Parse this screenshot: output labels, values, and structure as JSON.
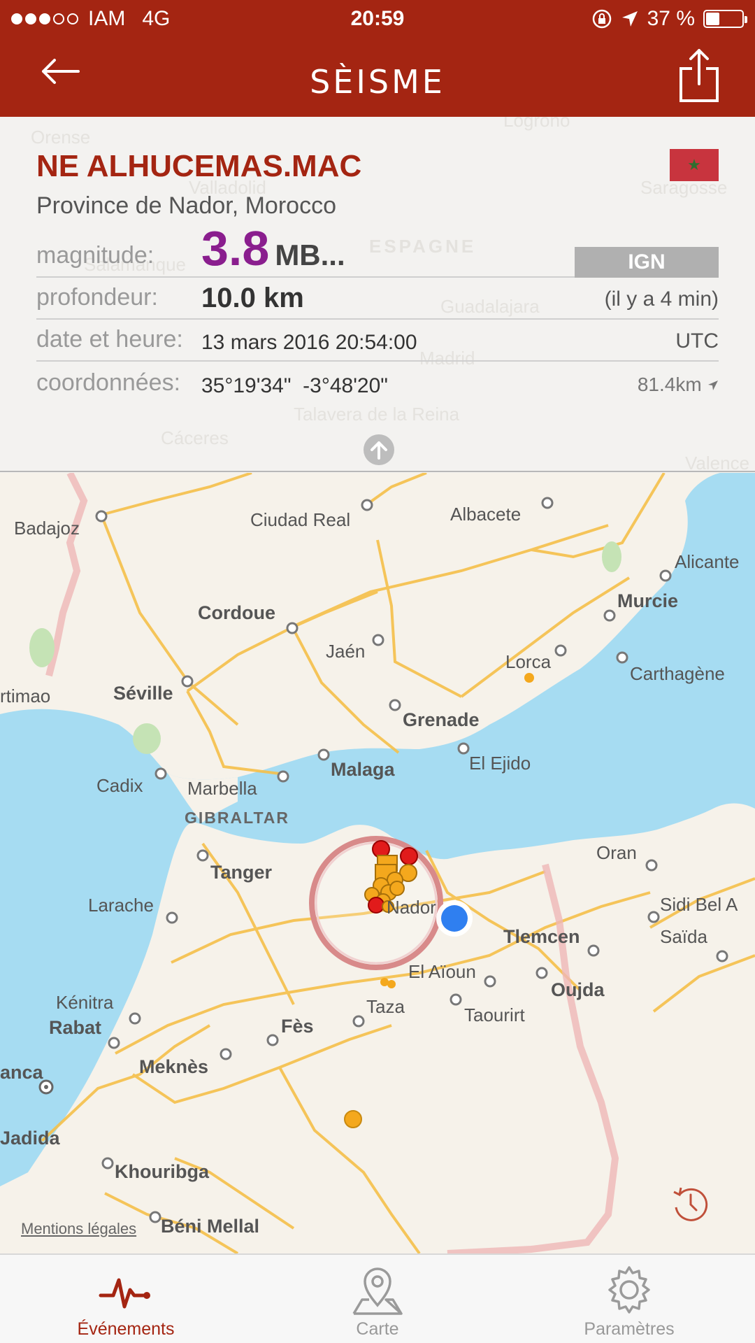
{
  "status": {
    "carrier": "IAM",
    "network": "4G",
    "time": "20:59",
    "battery": "37 %",
    "battery_level": 0.37,
    "signal_bars": 3
  },
  "header": {
    "title": "SÈISME",
    "back_icon": "arrow-left-icon",
    "share_icon": "share-icon"
  },
  "event": {
    "place": "NE ALHUCEMAS.MAC",
    "region": "Province de Nador, Morocco",
    "flag": "morocco-flag",
    "magnitude_label": "magnitude:",
    "magnitude": "3.8",
    "magnitude_unit": "MB...",
    "source_button": "IGN",
    "depth_label": "profondeur:",
    "depth": "10.0 km",
    "ago": "(il y a 4 min)",
    "datetime_label": "date et heure:",
    "datetime": "13 mars 2016 20:54:00",
    "timezone": "UTC",
    "coords_label": "coordonnées:",
    "coords": "35°19'34\"  -3°48'20\"",
    "distance": "81.4km"
  },
  "info_background": [
    "Orense",
    "Logroño",
    "Valladolid",
    "Saragosse",
    "ESPAGNE",
    "Guadalajara",
    "Madrid",
    "Talavera de la Reina",
    "Cáceres",
    "Valence",
    "Salamanque"
  ],
  "map": {
    "cities": {
      "badajoz": "Badajoz",
      "ciudad_real": "Ciudad Real",
      "albacete": "Albacete",
      "alicante": "Alicante",
      "cordoue": "Cordoue",
      "murcie": "Murcie",
      "jaen": "Jaén",
      "lorca": "Lorca",
      "carthagene": "Carthagène",
      "portimao": "rtimao",
      "seville": "Séville",
      "grenade": "Grenade",
      "malaga": "Malaga",
      "el_ejido": "El Ejido",
      "cadix": "Cadix",
      "marbella": "Marbella",
      "gibraltar": "GIBRALTAR",
      "oran": "Oran",
      "tanger": "Tanger",
      "larache": "Larache",
      "nador": "Nador",
      "sidi_bel_abbes": "Sidi Bel A",
      "tlemcen": "Tlemcen",
      "saida": "Saïda",
      "el_aioun": "El Aïoun",
      "oujda": "Oujda",
      "kenitra": "Kénitra",
      "taza": "Taza",
      "taourirt": "Taourirt",
      "rabat": "Rabat",
      "fes": "Fès",
      "meknes": "Meknès",
      "casablanca": "anca",
      "jadida": "Jadida",
      "khouribga": "Khouribga",
      "beni_mellal": "Béni Mellal"
    },
    "legal": "Mentions légales",
    "history_icon": "history-clock-icon"
  },
  "tabs": [
    {
      "label": "Événements",
      "icon": "pulse-icon"
    },
    {
      "label": "Carte",
      "icon": "map-pin-icon"
    },
    {
      "label": "Paramètres",
      "icon": "gear-icon"
    }
  ],
  "colors": {
    "brand": "#a42512",
    "magnitude": "#8a1e8e",
    "sea": "#a6dcf2",
    "roads": "#f5c04a",
    "quake_red": "#e11b1b",
    "quake_orange": "#f4a81d",
    "user_location": "#2f7ff0"
  }
}
